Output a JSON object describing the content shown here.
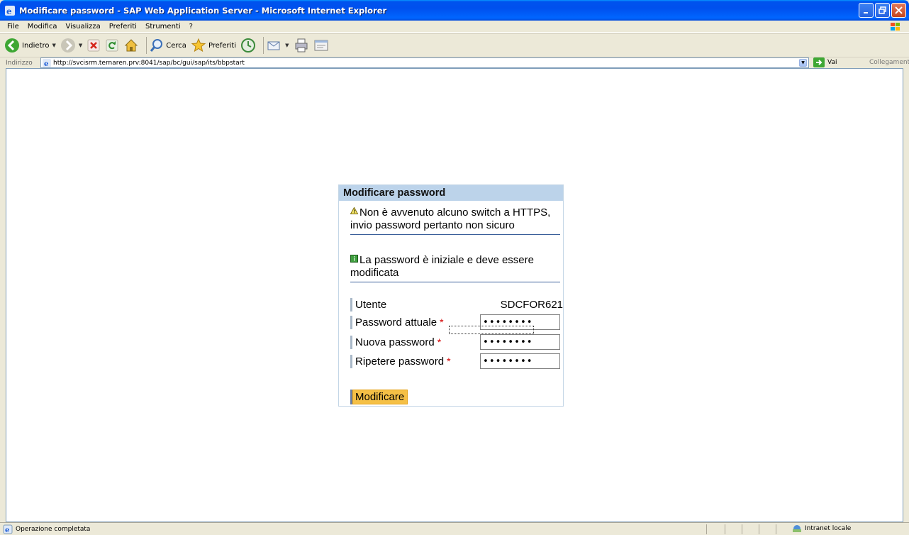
{
  "window": {
    "title": "Modificare password - SAP Web Application Server - Microsoft Internet Explorer"
  },
  "menubar": {
    "items": [
      {
        "label": "File",
        "key": "F"
      },
      {
        "label": "Modifica",
        "key": "M"
      },
      {
        "label": "Visualizza",
        "key": "V"
      },
      {
        "label": "Preferiti",
        "key": "P"
      },
      {
        "label": "Strumenti",
        "key": "S"
      },
      {
        "label": "?",
        "key": "?"
      }
    ]
  },
  "toolbar": {
    "back_label": "Indietro",
    "search_label": "Cerca",
    "favorites_label": "Preferiti"
  },
  "addressbar": {
    "label": "Indirizzo",
    "url": "http://svcisrm.ternaren.prv:8041/sap/bc/gui/sap/its/bbpstart",
    "go_label": "Vai",
    "links_label": "Collegamenti"
  },
  "form": {
    "title": "Modificare password",
    "warning_message": "Non è avvenuto alcuno switch a HTTPS, invio password pertanto non sicuro",
    "info_message": "La password è iniziale e deve essere modificata",
    "user_label": "Utente",
    "user_value": "SDCFOR621",
    "current_password_label": "Password attuale",
    "current_password_value": "••••••••",
    "new_password_label": "Nuova password",
    "new_password_value": "••••••••",
    "repeat_password_label": "Ripetere password",
    "repeat_password_value": "••••••••",
    "required_marker": "*",
    "submit_label": "Modificare"
  },
  "statusbar": {
    "text": "Operazione completata",
    "zone": "Intranet locale"
  },
  "colors": {
    "form_header_bg": "#bcd3ea",
    "button_bg": "#f5c046",
    "required_marker": "#d40000",
    "titlebar": "#0053ee"
  }
}
